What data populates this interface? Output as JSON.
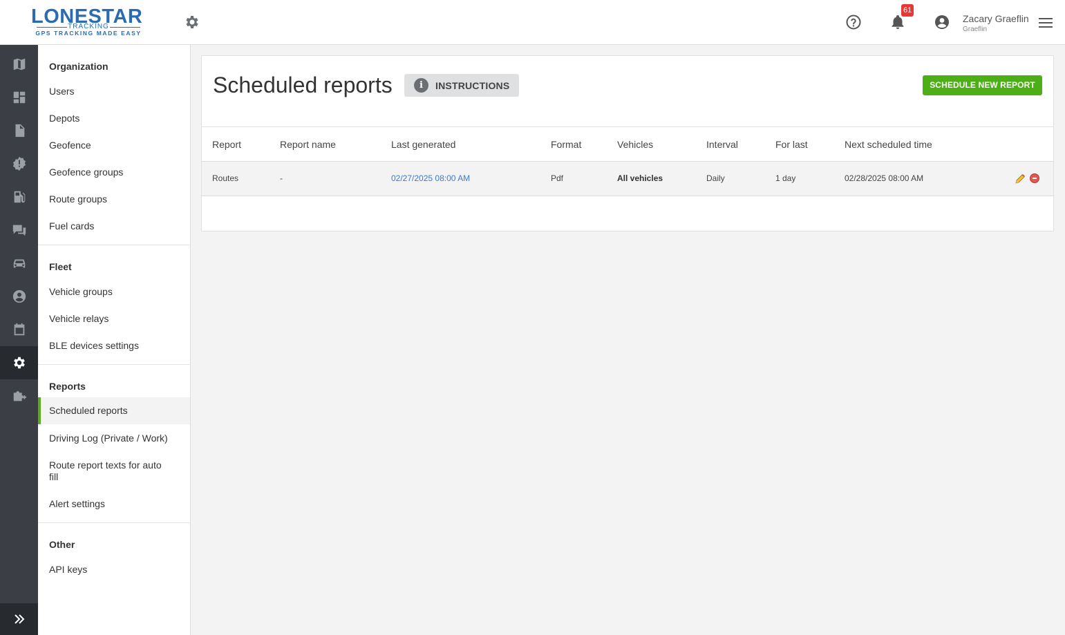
{
  "header": {
    "logo_main": "LONESTAR",
    "logo_sub": "TRACKING",
    "logo_tagline": "GPS TRACKING MADE EASY",
    "notification_count": "61",
    "user_name": "Zacary Graeflin",
    "user_org": "Graeflin"
  },
  "sidebar": {
    "sections": [
      {
        "title": "Organization",
        "items": [
          "Users",
          "Depots",
          "Geofence",
          "Geofence groups",
          "Route groups",
          "Fuel cards"
        ]
      },
      {
        "title": "Fleet",
        "items": [
          "Vehicle groups",
          "Vehicle relays",
          "BLE devices settings"
        ]
      },
      {
        "title": "Reports",
        "items": [
          "Scheduled reports",
          "Driving Log (Private / Work)",
          "Route report texts for auto fill",
          "Alert settings"
        ]
      },
      {
        "title": "Other",
        "items": [
          "API keys"
        ]
      }
    ],
    "active_item": "Scheduled reports"
  },
  "main": {
    "title": "Scheduled reports",
    "instructions_label": "INSTRUCTIONS",
    "new_report_label": "SCHEDULE NEW REPORT",
    "columns": [
      "Report",
      "Report name",
      "Last generated",
      "Format",
      "Vehicles",
      "Interval",
      "For last",
      "Next scheduled time"
    ],
    "rows": [
      {
        "report": "Routes",
        "report_name": "-",
        "last_generated": "02/27/2025 08:00 AM",
        "format": "Pdf",
        "vehicles": "All vehicles",
        "interval": "Daily",
        "for_last": "1 day",
        "next_scheduled": "02/28/2025 08:00 AM"
      }
    ]
  },
  "colors": {
    "accent_green": "#4caf16",
    "brand_blue": "#2b6cb0",
    "rail_bg": "#3b3f45",
    "link_blue": "#3a7bd5",
    "badge_red": "#e53935"
  }
}
